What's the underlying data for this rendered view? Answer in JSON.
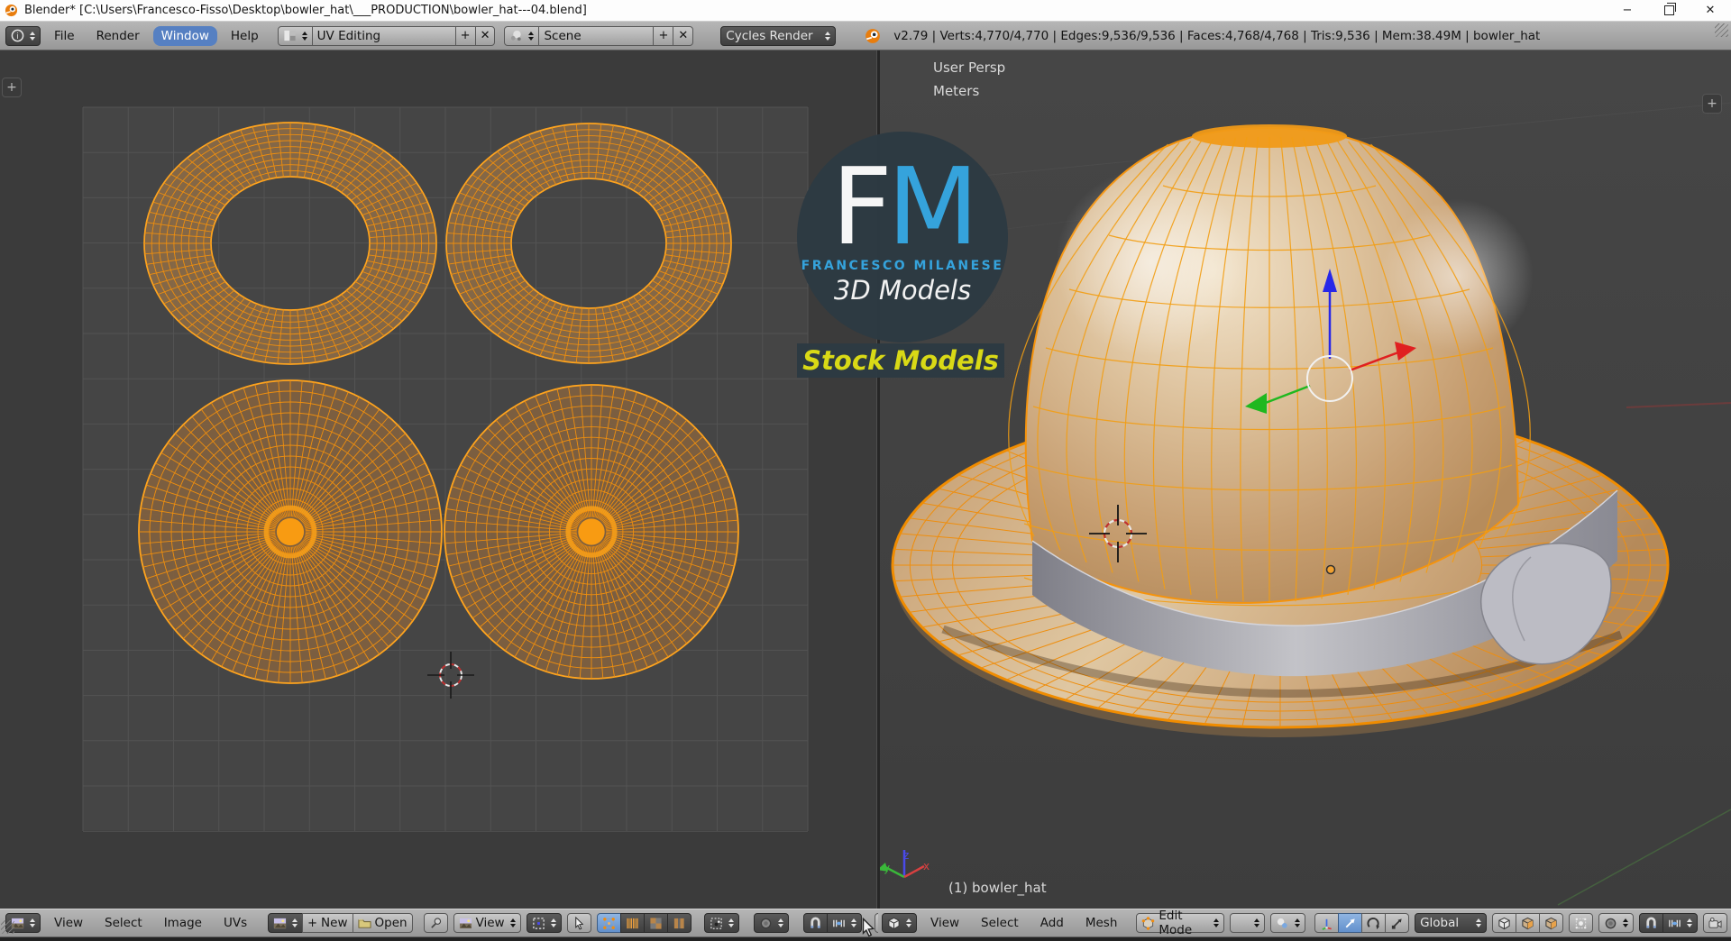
{
  "window": {
    "title": "Blender* [C:\\Users\\Francesco-Fisso\\Desktop\\bowler_hat\\___PRODUCTION\\bowler_hat---04.blend]",
    "minimize_glyph": "−",
    "close_glyph": "✕"
  },
  "header": {
    "menus": [
      "File",
      "Render",
      "Window",
      "Help"
    ],
    "active_menu": "Window",
    "layout_name": "UV Editing",
    "scene_name": "Scene",
    "engine": "Cycles Render",
    "stats": "v2.79 | Verts:4,770/4,770 | Edges:9,536/9,536 | Faces:4,768/4,768 | Tris:9,536 | Mem:38.49M | bowler_hat"
  },
  "icons": {
    "plus": "+",
    "cross": "✕"
  },
  "uv_editor": {
    "menus": [
      "View",
      "Select",
      "Image",
      "UVs"
    ],
    "new_label": "New",
    "open_label": "Open",
    "view_label": "View"
  },
  "viewport": {
    "menus": [
      "View",
      "Select",
      "Add",
      "Mesh"
    ],
    "mode_label": "Edit Mode",
    "orientation_label": "Global",
    "view_name": "User Persp",
    "units": "Meters",
    "object_info": "(1) bowler_hat",
    "axis": {
      "x": "x",
      "y": "y",
      "z": "z"
    }
  },
  "watermark": {
    "letter_f": "F",
    "letter_m": "M",
    "name": "FRANCESCO MILANESE",
    "subtitle": "3D Models",
    "banner": "Stock Models"
  },
  "colors": {
    "accent_blue": "#5680c2",
    "selection_orange": "#f5930c",
    "wire_orange": "#ee8e0e",
    "island_fill": "#8a6a46",
    "logo_blue": "#35a3dc",
    "banner_yellow": "#d9d916"
  }
}
